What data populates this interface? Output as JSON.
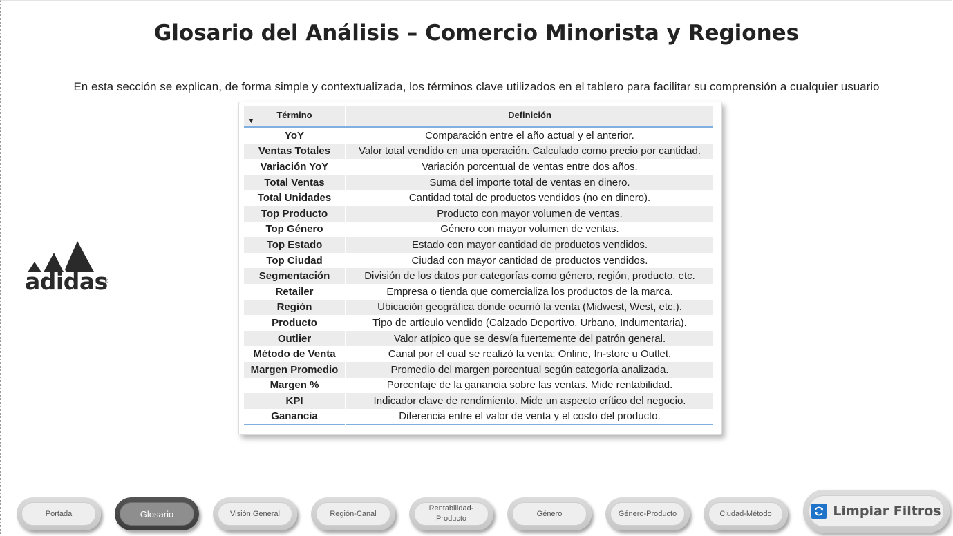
{
  "page": {
    "title": "Glosario del Análisis – Comercio Minorista y Regiones",
    "subtitle": "En esta sección se explican, de forma simple y contextualizada, los términos clave utilizados en el tablero para facilitar su comprensión a cualquier usuario"
  },
  "logo": {
    "brand": "adidas",
    "icon": "adidas-logo-icon"
  },
  "glossary": {
    "headers": {
      "term": "Término",
      "definition": "Definición"
    },
    "sort_icon": "sort-descending-icon",
    "rows": [
      {
        "term": "YoY",
        "definition": "Comparación entre el año actual y el anterior."
      },
      {
        "term": "Ventas Totales",
        "definition": "Valor total vendido en una operación. Calculado como precio por cantidad."
      },
      {
        "term": "Variación YoY",
        "definition": "Variación porcentual de ventas entre dos años."
      },
      {
        "term": "Total Ventas",
        "definition": "Suma del importe total de ventas en dinero."
      },
      {
        "term": "Total Unidades",
        "definition": "Cantidad total de productos vendidos (no en dinero)."
      },
      {
        "term": "Top Producto",
        "definition": "Producto con mayor volumen de ventas."
      },
      {
        "term": "Top Género",
        "definition": "Género con mayor volumen de ventas."
      },
      {
        "term": "Top Estado",
        "definition": "Estado con mayor cantidad de productos vendidos."
      },
      {
        "term": "Top Ciudad",
        "definition": "Ciudad con mayor cantidad de productos vendidos."
      },
      {
        "term": "Segmentación",
        "definition": "División de los datos por categorías como género, región, producto, etc."
      },
      {
        "term": "Retailer",
        "definition": "Empresa o tienda que comercializa los productos de la marca."
      },
      {
        "term": "Región",
        "definition": "Ubicación geográfica donde ocurrió la venta (Midwest, West, etc.)."
      },
      {
        "term": "Producto",
        "definition": "Tipo de artículo vendido (Calzado Deportivo, Urbano, Indumentaria)."
      },
      {
        "term": "Outlier",
        "definition": "Valor atípico que se desvía fuertemente del patrón general."
      },
      {
        "term": "Método de Venta",
        "definition": "Canal por el cual se realizó la venta: Online, In-store u Outlet."
      },
      {
        "term": "Margen Promedio",
        "definition": "Promedio del margen porcentual según categoría analizada."
      },
      {
        "term": "Margen %",
        "definition": "Porcentaje de la ganancia sobre las ventas. Mide rentabilidad."
      },
      {
        "term": "KPI",
        "definition": "Indicador clave de rendimiento. Mide un aspecto crítico del negocio."
      },
      {
        "term": "Ganancia",
        "definition": "Diferencia entre el valor de venta y el costo del producto."
      }
    ]
  },
  "nav": {
    "active": "Glosario",
    "items": [
      "Portada",
      "Glosario",
      "Visión General",
      "Región-Canal",
      "Rentabilidad-Producto",
      "Género",
      "Género-Producto",
      "Ciudad-Método"
    ],
    "display_lines": [
      [
        "Portada"
      ],
      [
        "Glosario"
      ],
      [
        "Visión General"
      ],
      [
        "Región-Canal"
      ],
      [
        "Rentabilidad-",
        "Producto"
      ],
      [
        "Género"
      ],
      [
        "Género-Producto"
      ],
      [
        "Ciudad-Método"
      ]
    ]
  },
  "clear_filters": {
    "label": "Limpiar Filtros",
    "icon": "refresh-icon"
  },
  "colors": {
    "accent_blue": "#1f73c9",
    "row_stripe": "#ececec",
    "header_underline": "#7fb0e0"
  }
}
